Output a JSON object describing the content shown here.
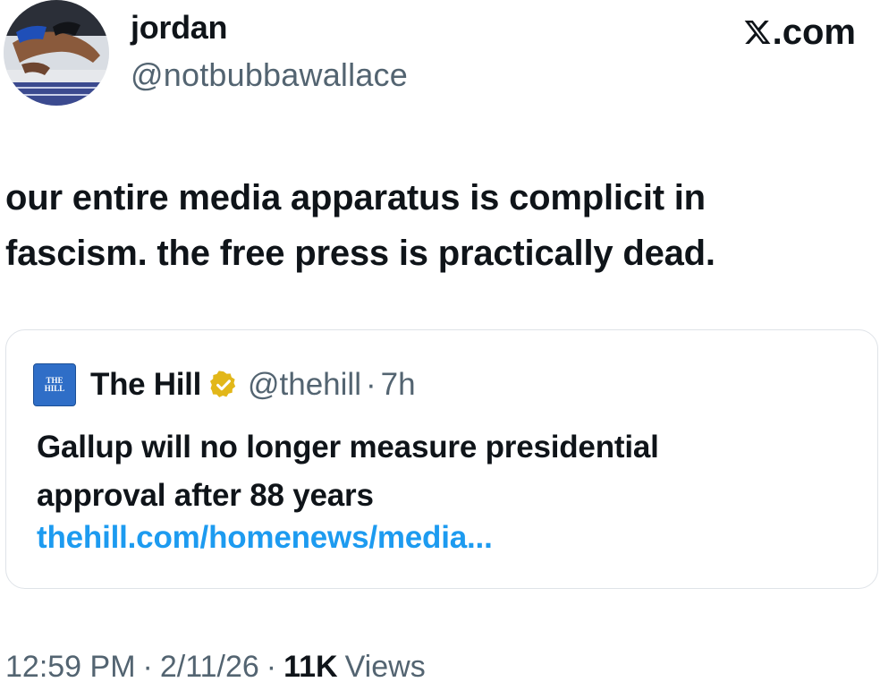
{
  "author": {
    "display_name": "jordan",
    "handle": "@notbubbawallace",
    "avatar_icon": "avatar-photo"
  },
  "brand": {
    "logo_icon": "x-logo-icon",
    "domain_suffix": ".com"
  },
  "tweet": {
    "text_line1": "our entire media apparatus is complicit in",
    "text_line2": "fascism. the free press is practically dead."
  },
  "quoted_tweet": {
    "logo_text_1": "THE",
    "logo_text_2": "HILL",
    "name": "The Hill",
    "verified_icon": "verified-badge-icon",
    "verified_color": "#e2b719",
    "handle": "@thehill",
    "separator": "·",
    "time": "7h",
    "text_line1": "Gallup will no longer measure presidential",
    "text_line2": "approval after 88 years",
    "link": "thehill.com/homenews/media..."
  },
  "meta": {
    "time": "12:59 PM",
    "date": "2/11/26",
    "separator": "·",
    "views_count": "11K",
    "views_label": "Views"
  },
  "colors": {
    "link": "#1d9bf0",
    "secondary_text": "#536471",
    "primary_text": "#0f1419",
    "card_border": "#dfe3e8"
  }
}
